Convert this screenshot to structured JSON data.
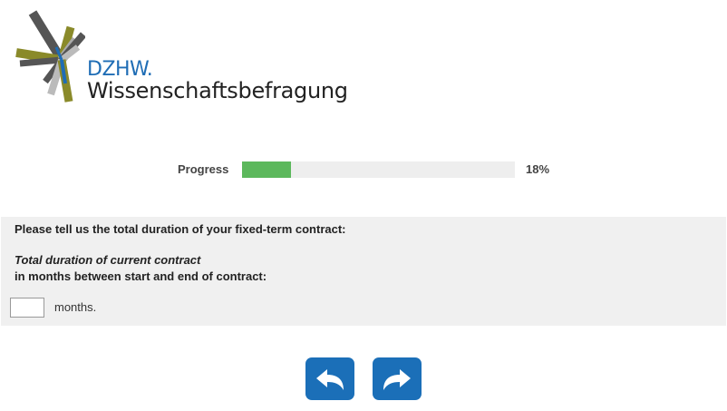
{
  "logo": {
    "brand": "DZHW.",
    "subtitle": "Wissenschaftsbefragung",
    "colors": {
      "olive": "#8a8a2a",
      "gray": "#9a9a9a",
      "dark": "#555555",
      "blue": "#1f6db5"
    }
  },
  "progress": {
    "label": "Progress",
    "value": 0.18,
    "percent_text": "18%",
    "color": "#5cb85c"
  },
  "question": {
    "text": "Please tell us the total duration of your fixed-term contract:",
    "subtitle_italic": "Total duration of current contract",
    "subtitle": "in months between start and end of contract:",
    "input_value": "",
    "unit": "months."
  },
  "nav": {
    "back_icon": "back-arrow-icon",
    "next_icon": "forward-arrow-icon",
    "button_color": "#1b6fb8"
  }
}
